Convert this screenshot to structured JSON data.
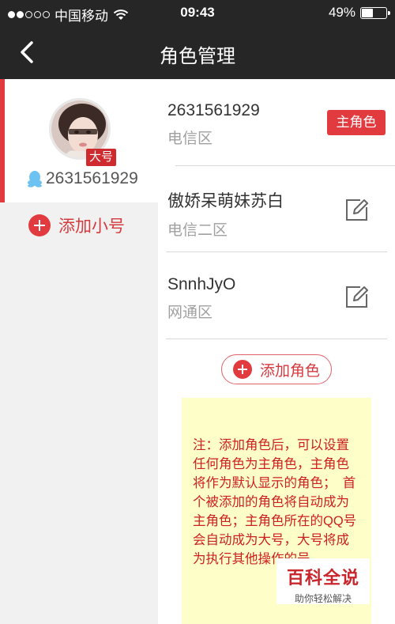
{
  "status_bar": {
    "carrier": "中国移动",
    "time": "09:43",
    "battery": "49%",
    "battery_level": 0.49,
    "signal_bars": 2,
    "signal_total": 5
  },
  "nav": {
    "title": "角色管理"
  },
  "sidebar": {
    "account_badge": "大号",
    "account_number": "2631561929",
    "add_small_label": "添加小号"
  },
  "roles": [
    {
      "name": "2631561929",
      "zone": "电信区",
      "tag": "主角色"
    },
    {
      "name": "傲娇呆萌妹苏白",
      "zone": "电信二区"
    },
    {
      "name": "SnnhJyO",
      "zone": "网通区"
    }
  ],
  "add_role_label": "添加角色",
  "note": "注：添加角色后，可以设置任何角色为主角色，主角色将作为默认显示的角色；　首个被添加的角色将自动成为主角色；主角色所在的QQ号会自动成为大号，大号将成为执行其他操作的号。",
  "watermark": {
    "main": "百科全说",
    "sub": "助你轻松解决"
  },
  "colors": {
    "accent": "#e23b3f",
    "header": "#262626",
    "note_bg": "#fefec8"
  }
}
